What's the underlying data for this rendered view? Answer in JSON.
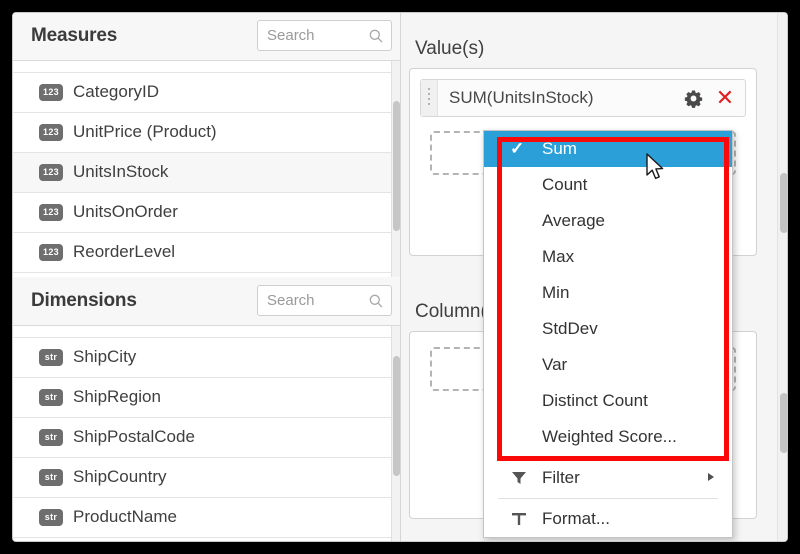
{
  "left_pane": {
    "measures": {
      "title": "Measures",
      "search_placeholder": "Search",
      "search_value": "",
      "search_icon": "search-icon",
      "fields": [
        {
          "type": "123",
          "label": "CategoryID"
        },
        {
          "type": "123",
          "label": "UnitPrice (Product)"
        },
        {
          "type": "123",
          "label": "UnitsInStock"
        },
        {
          "type": "123",
          "label": "UnitsOnOrder"
        },
        {
          "type": "123",
          "label": "ReorderLevel"
        }
      ]
    },
    "dimensions": {
      "title": "Dimensions",
      "search_placeholder": "Search",
      "search_value": "",
      "search_icon": "search-icon",
      "fields": [
        {
          "type": "str",
          "label": "ShipCity"
        },
        {
          "type": "str",
          "label": "ShipRegion"
        },
        {
          "type": "str",
          "label": "ShipPostalCode"
        },
        {
          "type": "str",
          "label": "ShipCountry"
        },
        {
          "type": "str",
          "label": "ProductName"
        }
      ]
    }
  },
  "right_pane": {
    "values_zone": {
      "label": "Value(s)",
      "chip": {
        "label": "SUM(UnitsInStock)",
        "gear_icon": "gear-icon",
        "close_icon": "close-icon",
        "grip_icon": "drag-handle-icon"
      }
    },
    "columns_zone": {
      "label": "Column(s)"
    }
  },
  "dropdown": {
    "aggregations": [
      {
        "label": "Sum",
        "selected": true
      },
      {
        "label": "Count",
        "selected": false
      },
      {
        "label": "Average",
        "selected": false
      },
      {
        "label": "Max",
        "selected": false
      },
      {
        "label": "Min",
        "selected": false
      },
      {
        "label": "StdDev",
        "selected": false
      },
      {
        "label": "Var",
        "selected": false
      },
      {
        "label": "Distinct Count",
        "selected": false
      },
      {
        "label": "Weighted Score...",
        "selected": false
      }
    ],
    "check_glyph": "✓",
    "actions": [
      {
        "label": "Filter",
        "icon": "filter-icon",
        "has_submenu": true
      },
      {
        "label": "Format...",
        "icon": "text-format-icon",
        "has_submenu": false
      }
    ]
  },
  "colors": {
    "selection_blue": "#2a9fd8",
    "highlight_red": "#fb0909",
    "close_red": "#e02020",
    "badge_gray": "#6e6e6e"
  }
}
